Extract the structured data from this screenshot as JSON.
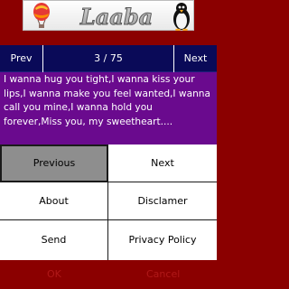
{
  "header": {
    "logo_text": "Laaba"
  },
  "nav": {
    "prev_label": "Prev",
    "page_indicator": "3 / 75",
    "next_label": "Next"
  },
  "message": {
    "text": "I wanna hug you tight,I wanna kiss your lips,I wanna make you feel wanted,I wanna call you mine,I wanna hold you forever,Miss you, my sweetheart...."
  },
  "menu": {
    "previous": "Previous",
    "next": "Next",
    "about": "About",
    "disclaimer": "Disclamer",
    "send": "Send",
    "privacy_policy": "Privacy Policy"
  },
  "softkeys": {
    "ok": "OK",
    "cancel": "Cancel"
  },
  "colors": {
    "background": "#8b0000",
    "navbar": "#0a0a58",
    "message_panel": "#6a0a8e",
    "selected_button": "#8e8e8e"
  },
  "icons": [
    "hot-air-balloon-icon",
    "penguin-icon"
  ]
}
